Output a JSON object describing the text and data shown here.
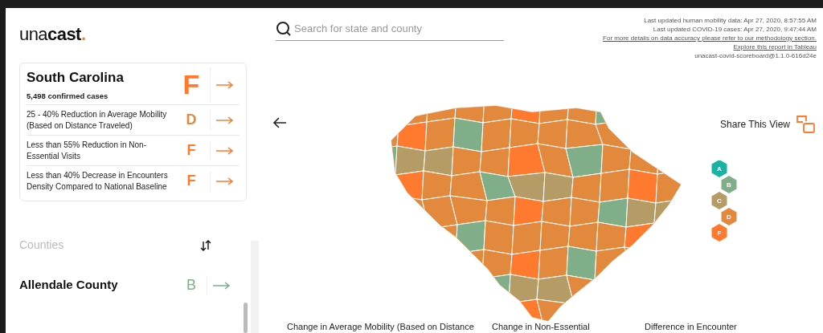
{
  "logo": {
    "text": "una",
    "bold": "cast",
    "dot": "."
  },
  "state_card": {
    "name": "South Carolina",
    "cases": "5,498 confirmed cases",
    "grade": "F",
    "color": "#ff7a2f",
    "metrics": [
      {
        "text": "25 - 40% Reduction in Average Mobility (Based on Distance Traveled)",
        "grade": "D",
        "color": "#e3893d"
      },
      {
        "text": "Less than 55% Reduction in Non-Essential Visits",
        "grade": "F",
        "color": "#ff7a2f"
      },
      {
        "text": "Less than 40% Decrease in Encounters Density Compared to National Baseline",
        "grade": "F",
        "color": "#ff7a2f"
      }
    ]
  },
  "counties": {
    "title": "Counties",
    "items": [
      {
        "name": "Allendale County",
        "grade": "B",
        "color": "#7fae88"
      }
    ]
  },
  "search": {
    "placeholder": "Search for state and county"
  },
  "meta": {
    "lines": [
      {
        "text": "Last updated human mobility data: Apr 27, 2020, 8:57:55 AM",
        "kind": "plain"
      },
      {
        "text": "Last updated COVID-19 cases: Apr 27, 2020, 9:47:44 AM",
        "kind": "plain"
      },
      {
        "text": "For more details on data accuracy please refer to our methodology section.",
        "kind": "link"
      },
      {
        "text": "Explore this report in Tableau",
        "kind": "link"
      },
      {
        "text": "unacast-covid-scoreboard@1.1.0-616d24e",
        "kind": "plain"
      }
    ]
  },
  "share": {
    "label": "Share This View"
  },
  "legend": [
    {
      "label": "A",
      "color": "#19b3a3"
    },
    {
      "label": "B",
      "color": "#7fae88"
    },
    {
      "label": "C",
      "color": "#b59c66"
    },
    {
      "label": "D",
      "color": "#e3893d"
    },
    {
      "label": "F",
      "color": "#ff7a2f"
    }
  ],
  "chart_titles": [
    "Change in Average Mobility (Based on Distance",
    "Change in Non-Essential",
    "Difference in Encounter"
  ]
}
